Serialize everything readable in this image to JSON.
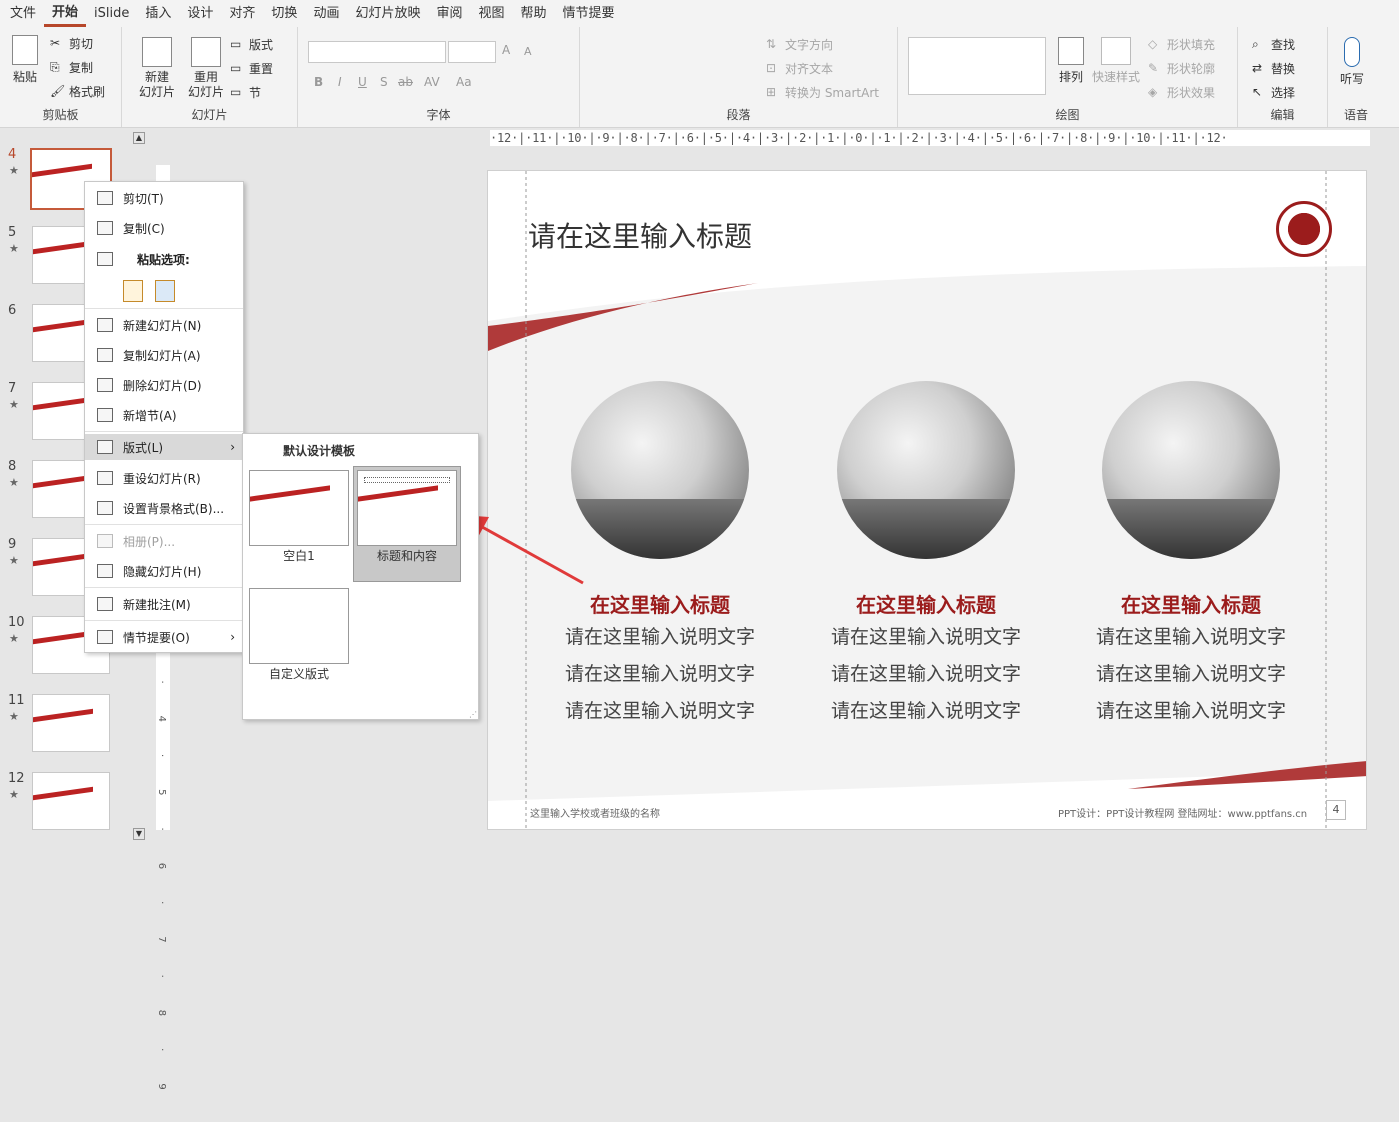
{
  "menubar": {
    "tabs": [
      "文件",
      "开始",
      "iSlide",
      "插入",
      "设计",
      "对齐",
      "切换",
      "动画",
      "幻灯片放映",
      "审阅",
      "视图",
      "帮助",
      "情节提要"
    ],
    "active": "开始"
  },
  "ribbon": {
    "clipboard": {
      "label": "剪贴板",
      "paste": "粘贴",
      "cut": "剪切",
      "copy": "复制",
      "format_painter": "格式刷"
    },
    "slides": {
      "label": "幻灯片",
      "new_slide": "新建\n幻灯片",
      "reuse_slide": "重用\n幻灯片",
      "layout": "版式",
      "reset": "重置",
      "section": "节"
    },
    "font": {
      "label": "字体",
      "bold": "B",
      "italic": "I",
      "underline": "U",
      "shadow": "S",
      "strike": "ab",
      "spacing": "AV",
      "case": "Aa",
      "grow": "A",
      "shrink": "A"
    },
    "paragraph": {
      "label": "段落",
      "text_direction": "文字方向",
      "align_text": "对齐文本",
      "smartart": "转换为 SmartArt"
    },
    "drawing": {
      "label": "绘图",
      "arrange": "排列",
      "quick_styles": "快速样式",
      "fill": "形状填充",
      "outline": "形状轮廓",
      "effects": "形状效果"
    },
    "editing": {
      "label": "编辑",
      "find": "查找",
      "replace": "替换",
      "select": "选择"
    },
    "voice": {
      "label": "语音",
      "dictate": "听写"
    }
  },
  "ruler": {
    "h": "·12·|·11·|·10·|·9·|·8·|·7·|·6·|·5·|·4·|·3·|·2·|·1·|·0·|·1·|·2·|·3·|·4·|·5·|·6·|·7·|·8·|·9·|·10·|·11·|·12·",
    "v": "1·2·3·4·5·6·7·8·9"
  },
  "thumbnails": [
    {
      "num": "4",
      "star": "★"
    },
    {
      "num": "5",
      "star": "★"
    },
    {
      "num": "6",
      "star": ""
    },
    {
      "num": "7",
      "star": "★"
    },
    {
      "num": "8",
      "star": "★"
    },
    {
      "num": "9",
      "star": "★"
    },
    {
      "num": "10",
      "star": "★"
    },
    {
      "num": "11",
      "star": "★"
    },
    {
      "num": "12",
      "star": "★"
    }
  ],
  "slide": {
    "title": "请在这里输入标题",
    "columns": [
      {
        "title": "在这里输入标题",
        "lines": [
          "请在这里输入说明文字",
          "请在这里输入说明文字",
          "请在这里输入说明文字"
        ]
      },
      {
        "title": "在这里输入标题",
        "lines": [
          "请在这里输入说明文字",
          "请在这里输入说明文字",
          "请在这里输入说明文字"
        ]
      },
      {
        "title": "在这里输入标题",
        "lines": [
          "请在这里输入说明文字",
          "请在这里输入说明文字",
          "请在这里输入说明文字"
        ]
      }
    ],
    "footer_left": "这里输入学校或者班级的名称",
    "footer_right": "PPT设计：PPT设计教程网    登陆网址：www.pptfans.cn",
    "page": "4",
    "accent": "#b22222"
  },
  "context_menu": {
    "cut": "剪切(T)",
    "copy": "复制(C)",
    "paste_options": "粘贴选项:",
    "new_slide": "新建幻灯片(N)",
    "duplicate": "复制幻灯片(A)",
    "delete": "删除幻灯片(D)",
    "add_section": "新增节(A)",
    "layout": "版式(L)",
    "reset": "重设幻灯片(R)",
    "bg_format": "设置背景格式(B)...",
    "album": "相册(P)...",
    "hide": "隐藏幻灯片(H)",
    "comment": "新建批注(M)",
    "storyboard": "情节提要(O)"
  },
  "layout_submenu": {
    "header": "默认设计模板",
    "items": [
      "空白1",
      "标题和内容",
      "自定义版式"
    ]
  }
}
